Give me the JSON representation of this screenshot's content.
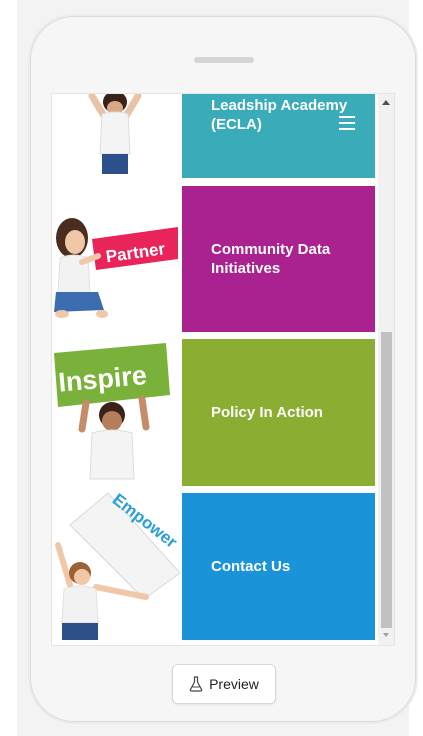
{
  "preview": {
    "label": "Preview",
    "icon": "flask-icon"
  },
  "tiles": [
    {
      "label": "Leadship Academy (ECLA)",
      "color": "#3aabb8"
    },
    {
      "label": "Community Data Initiatives",
      "color": "#a9228f"
    },
    {
      "label": "Policy In Action",
      "color": "#8aad32"
    },
    {
      "label": "Contact Us",
      "color": "#1a93d8"
    }
  ],
  "signs": {
    "partner": "Partner",
    "inspire": "Inspire",
    "empower": "Empower"
  },
  "colors": {
    "partner_sign": "#e8245a",
    "inspire_sign": "#7ab13a",
    "empower_text": "#2a9fd8"
  }
}
